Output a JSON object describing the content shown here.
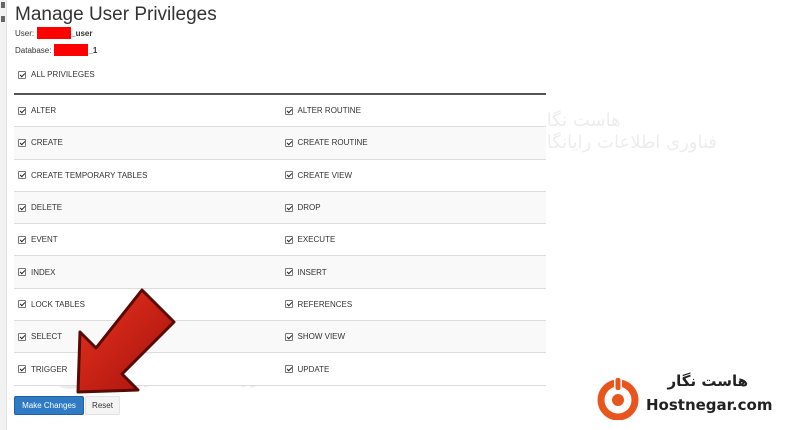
{
  "page": {
    "title": "Manage User Privileges",
    "user_label": "User:",
    "user_suffix": "_user",
    "database_label": "Database:",
    "database_suffix": "_1"
  },
  "all_privileges": {
    "label": "ALL PRIVILEGES",
    "checked": true
  },
  "privileges": [
    {
      "left": "ALTER",
      "right": "ALTER ROUTINE"
    },
    {
      "left": "CREATE",
      "right": "CREATE ROUTINE"
    },
    {
      "left": "CREATE TEMPORARY TABLES",
      "right": "CREATE VIEW"
    },
    {
      "left": "DELETE",
      "right": "DROP"
    },
    {
      "left": "EVENT",
      "right": "EXECUTE"
    },
    {
      "left": "INDEX",
      "right": "INSERT"
    },
    {
      "left": "LOCK TABLES",
      "right": "REFERENCES"
    },
    {
      "left": "SELECT",
      "right": "SHOW VIEW"
    },
    {
      "left": "TRIGGER",
      "right": "UPDATE"
    }
  ],
  "buttons": {
    "make_changes": "Make Changes",
    "reset": "Reset"
  },
  "watermark": {
    "line1": "هاست نگار",
    "line2": "فناوری اطلاعات رایانگار"
  },
  "brand": {
    "name_fa": "هاست نگار",
    "name_en": "Hostnegar.com"
  },
  "colors": {
    "primary": "#2e7ac4",
    "redaction": "#ff0000",
    "arrow": "#c41a12",
    "brand": "#e8561e"
  },
  "icons": {
    "checkbox": "checkmark-icon",
    "arrow": "red-arrow-icon",
    "brand_logo": "hostnegar-logo-icon"
  }
}
